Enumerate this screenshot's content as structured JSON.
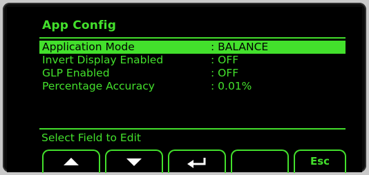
{
  "screen": {
    "title": "App Config",
    "rows": [
      {
        "label": "Application Mode",
        "value": ": BALANCE"
      },
      {
        "label": "Invert Display Enabled",
        "value": ": OFF"
      },
      {
        "label": "GLP Enabled",
        "value": ": OFF"
      },
      {
        "label": "Percentage Accuracy",
        "value": ": 0.01%"
      }
    ],
    "status": "Select Field to Edit"
  },
  "softkeys": {
    "up_icon": "up-arrow-icon",
    "down_icon": "down-arrow-icon",
    "enter_icon": "enter-icon",
    "esc_label": "Esc"
  },
  "colors": {
    "foreground": "#43e02c",
    "background": "#000000"
  }
}
